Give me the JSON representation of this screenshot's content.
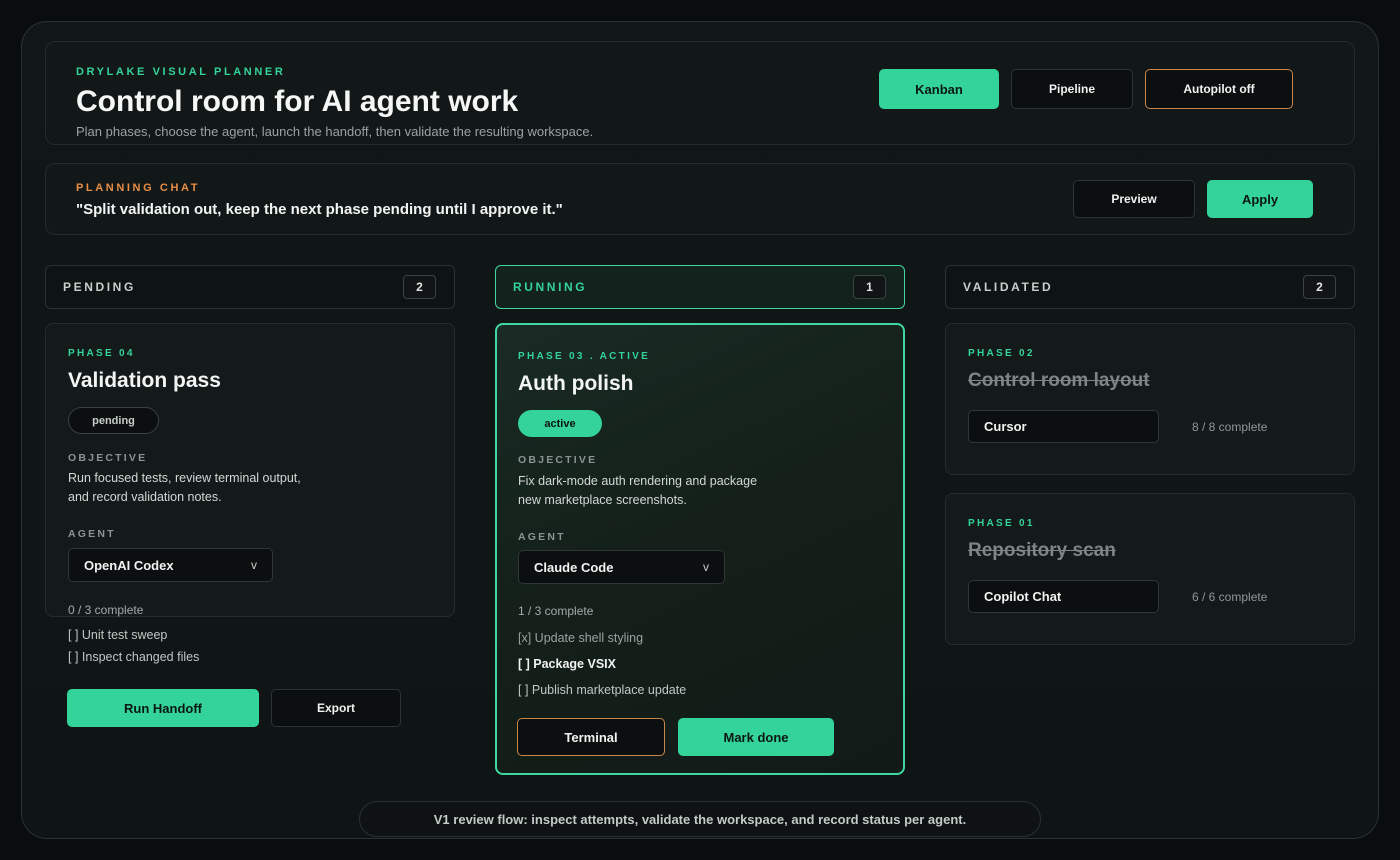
{
  "header": {
    "eyebrow": "DRYLAKE VISUAL PLANNER",
    "title": "Control room for AI agent work",
    "subtitle": "Plan phases, choose the agent, launch the handoff, then validate the resulting workspace.",
    "buttons": {
      "kanban": "Kanban",
      "pipeline": "Pipeline",
      "autopilot": "Autopilot off"
    }
  },
  "chat": {
    "eyebrow": "PLANNING CHAT",
    "message": "\"Split validation out, keep the next phase pending until I approve it.\"",
    "preview_label": "Preview",
    "apply_label": "Apply"
  },
  "columns": {
    "pending": {
      "label": "PENDING",
      "count": "2"
    },
    "running": {
      "label": "RUNNING",
      "count": "1"
    },
    "validated": {
      "label": "VALIDATED",
      "count": "2"
    }
  },
  "pending_card": {
    "phase": "PHASE 04",
    "title": "Validation pass",
    "status": "pending",
    "objective_label": "OBJECTIVE",
    "objective_line1": "Run focused tests, review terminal output,",
    "objective_line2": "and record validation notes.",
    "agent_label": "AGENT",
    "agent": "OpenAI Codex",
    "chevron": "v",
    "progress": "0 / 3 complete",
    "tasks": [
      "[ ] Unit test sweep",
      "[ ] Inspect changed files"
    ],
    "run_label": "Run Handoff",
    "export_label": "Export"
  },
  "active_card": {
    "phase": "PHASE 03 . ACTIVE",
    "title": "Auth polish",
    "status": "active",
    "objective_label": "OBJECTIVE",
    "objective_line1": "Fix dark-mode auth rendering and package",
    "objective_line2": "new marketplace screenshots.",
    "agent_label": "AGENT",
    "agent": "Claude Code",
    "chevron": "v",
    "progress": "1 / 3 complete",
    "tasks": [
      "[x] Update shell styling",
      "[ ] Package VSIX",
      "[ ] Publish marketplace update"
    ],
    "terminal_label": "Terminal",
    "done_label": "Mark done"
  },
  "validated_cards": [
    {
      "phase": "PHASE 02",
      "title": "Control room layout",
      "agent": "Cursor",
      "progress": "8 / 8 complete"
    },
    {
      "phase": "PHASE 01",
      "title": "Repository scan",
      "agent": "Copilot Chat",
      "progress": "6 / 6 complete"
    }
  ],
  "footer": "V1 review flow: inspect attempts, validate the workspace, and record status per agent.",
  "colors": {
    "accent": "#33d39a",
    "warm": "#e88e45",
    "background": "#0a0d0d"
  }
}
